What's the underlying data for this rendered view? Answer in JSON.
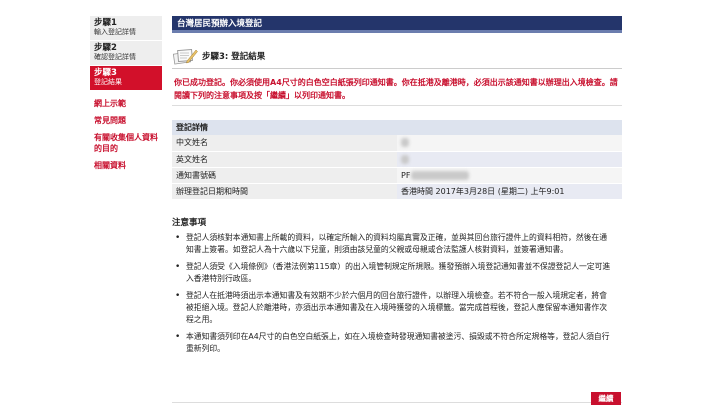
{
  "sidebar": {
    "steps": [
      {
        "title": "步驟1",
        "subtitle": "輸入登記詳情"
      },
      {
        "title": "步驟2",
        "subtitle": "確認登記詳情"
      },
      {
        "title": "步驟3",
        "subtitle": "登記結果"
      }
    ],
    "links": [
      "網上示範",
      "常見問題",
      "有關收集個人資料的目的",
      "相關資料"
    ]
  },
  "header": {
    "title": "台灣居民預辦入境登記"
  },
  "step_heading": "步驟3: 登記結果",
  "notice": "你已成功登記。你必須使用A4尺寸的白色空白紙張列印通知書。你在抵港及離港時，必須出示該通知書以辦理出入境檢查。請閱讀下列的注意事項及按「繼續」以列印通知書。",
  "details": {
    "header": "登記詳情",
    "rows": [
      {
        "label": "中文姓名",
        "value": ""
      },
      {
        "label": "英文姓名",
        "value": ""
      },
      {
        "label": "通知書號碼",
        "value": "PF"
      },
      {
        "label": "辦理登記日期和時間",
        "value": "香港時間 2017年3月28日 (星期二) 上午9:01"
      }
    ]
  },
  "notes": {
    "title": "注意事項",
    "items": [
      "登記人須核對本通知書上所載的資料，以確定所輸入的資料均屬真實及正確，並與其回台旅行證件上的資料相符，然後在通知書上簽署。如登記人為十六歲以下兒童，則須由該兒童的父親或母親或合法監護人核對資料，並簽署通知書。",
      "登記人須受《入境條例》（香港法例第115章）的出入境管制規定所規限。獲發預辦入境登記通知書並不保證登記人一定可進入香港特別行政區。",
      "登記人在抵港時須出示本通知書及有效期不少於六個月的回台旅行證件，以辦理入境檢查。若不符合一般入境規定者，將會被拒絕入境。登記人於離港時，亦須出示本通知書及在入境時獲發的入境標籤。當完成首程後，登記人應保留本通知書作次程之用。",
      "本通知書須列印在A4尺寸的白色空白紙張上，如在入境檢查時發現通知書被塗污、損毀或不符合所定規格等，登記人須自行重新列印。"
    ]
  },
  "continue_label": "繼續",
  "colors": {
    "accent_red": "#c8102e",
    "header_navy": "#24356b"
  }
}
